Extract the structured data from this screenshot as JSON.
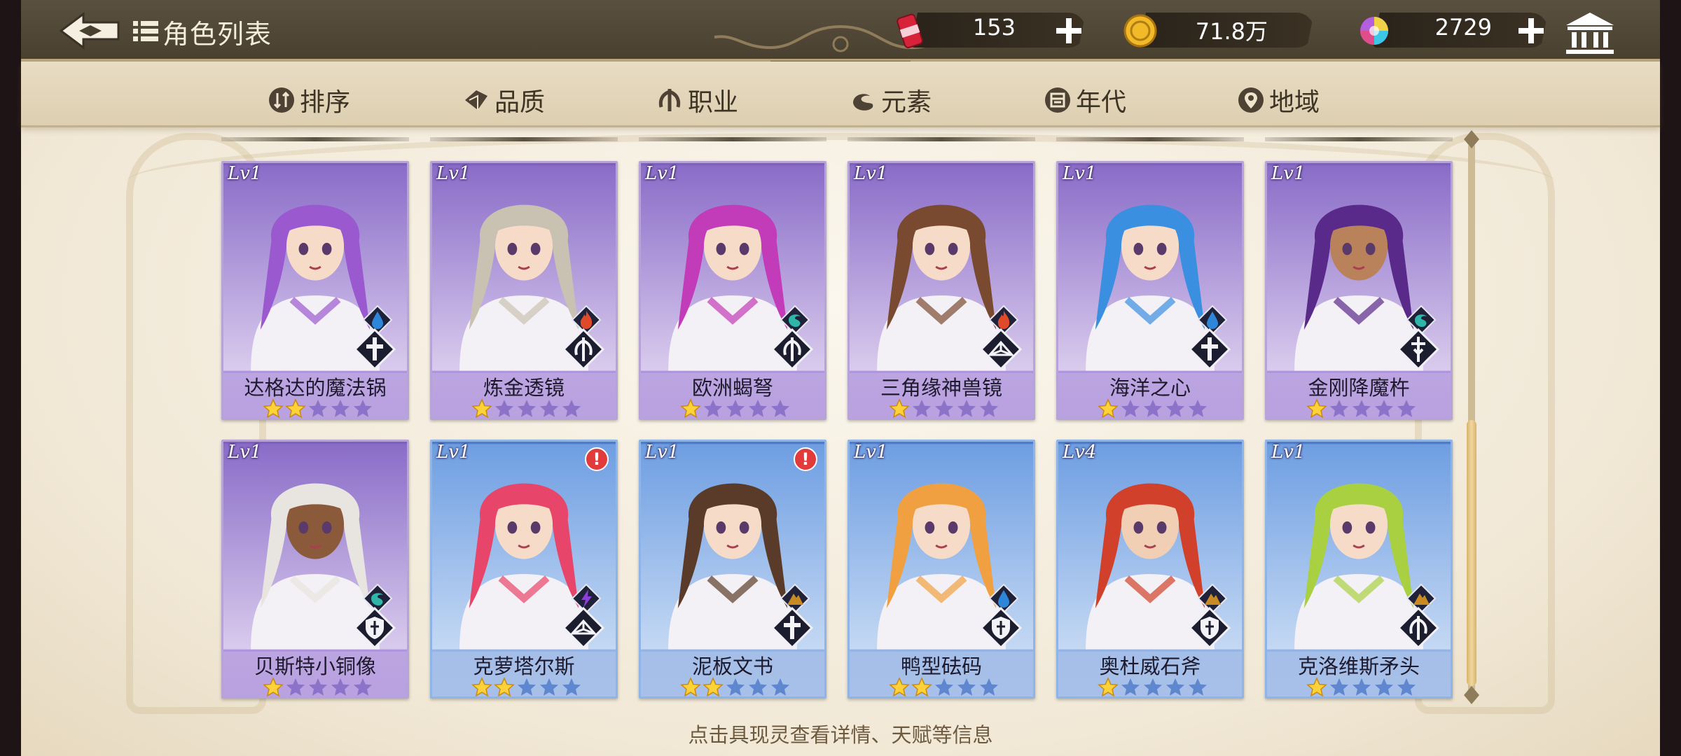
{
  "header": {
    "title": "角色列表",
    "currencies": [
      {
        "name": "stamina",
        "icon": "soda-can-icon",
        "value": "153"
      },
      {
        "name": "gold",
        "icon": "gold-coin-icon",
        "value": "71.8万"
      },
      {
        "name": "gems",
        "icon": "rainbow-gem-icon",
        "value": "2729"
      }
    ]
  },
  "filters": [
    {
      "label": "排序",
      "icon": "sort-icon"
    },
    {
      "label": "品质",
      "icon": "quality-icon"
    },
    {
      "label": "职业",
      "icon": "class-icon"
    },
    {
      "label": "元素",
      "icon": "element-icon"
    },
    {
      "label": "年代",
      "icon": "era-icon"
    },
    {
      "label": "地域",
      "icon": "region-icon"
    }
  ],
  "characters": [
    {
      "level": "Lv1",
      "name": "达格达的魔法锅",
      "stars": 2,
      "frame": "purple",
      "element": "water",
      "class": "cross",
      "alert": false
    },
    {
      "level": "Lv1",
      "name": "炼金透镜",
      "stars": 1,
      "frame": "purple",
      "element": "fire",
      "class": "trident",
      "alert": false
    },
    {
      "level": "Lv1",
      "name": "欧洲蝎弩",
      "stars": 1,
      "frame": "purple",
      "element": "wind",
      "class": "trident",
      "alert": false
    },
    {
      "level": "Lv1",
      "name": "三角缘神兽镜",
      "stars": 1,
      "frame": "purple",
      "element": "fire",
      "class": "book",
      "alert": false
    },
    {
      "level": "Lv1",
      "name": "海洋之心",
      "stars": 1,
      "frame": "purple",
      "element": "water",
      "class": "cross",
      "alert": false
    },
    {
      "level": "Lv1",
      "name": "金刚降魔杵",
      "stars": 1,
      "frame": "purple",
      "element": "wind",
      "class": "sword",
      "alert": false
    },
    {
      "level": "Lv1",
      "name": "贝斯特小铜像",
      "stars": 1,
      "frame": "purple",
      "element": "wind",
      "class": "shield",
      "alert": false
    },
    {
      "level": "Lv1",
      "name": "克萝塔尔斯",
      "stars": 2,
      "frame": "blue",
      "element": "thunder",
      "class": "book",
      "alert": true
    },
    {
      "level": "Lv1",
      "name": "泥板文书",
      "stars": 2,
      "frame": "blue",
      "element": "earth",
      "class": "cross",
      "alert": true
    },
    {
      "level": "Lv1",
      "name": "鸭型砝码",
      "stars": 2,
      "frame": "blue",
      "element": "water",
      "class": "shield",
      "alert": false
    },
    {
      "level": "Lv4",
      "name": "奥杜威石斧",
      "stars": 1,
      "frame": "blue",
      "element": "earth",
      "class": "shield",
      "alert": false
    },
    {
      "level": "Lv1",
      "name": "克洛维斯矛头",
      "stars": 1,
      "frame": "blue",
      "element": "earth",
      "class": "trident",
      "alert": false
    }
  ],
  "max_stars": 5,
  "hint": "点击具现灵查看详情、天赋等信息",
  "colors": {
    "water": "#2e86d8",
    "fire": "#e04a2a",
    "wind": "#2fb6a8",
    "thunder": "#8a3fd6",
    "earth": "#c88a22",
    "star_on": "#ffd23a",
    "star_off_purple": "#8c72c8",
    "star_off_blue": "#5f87cf"
  }
}
